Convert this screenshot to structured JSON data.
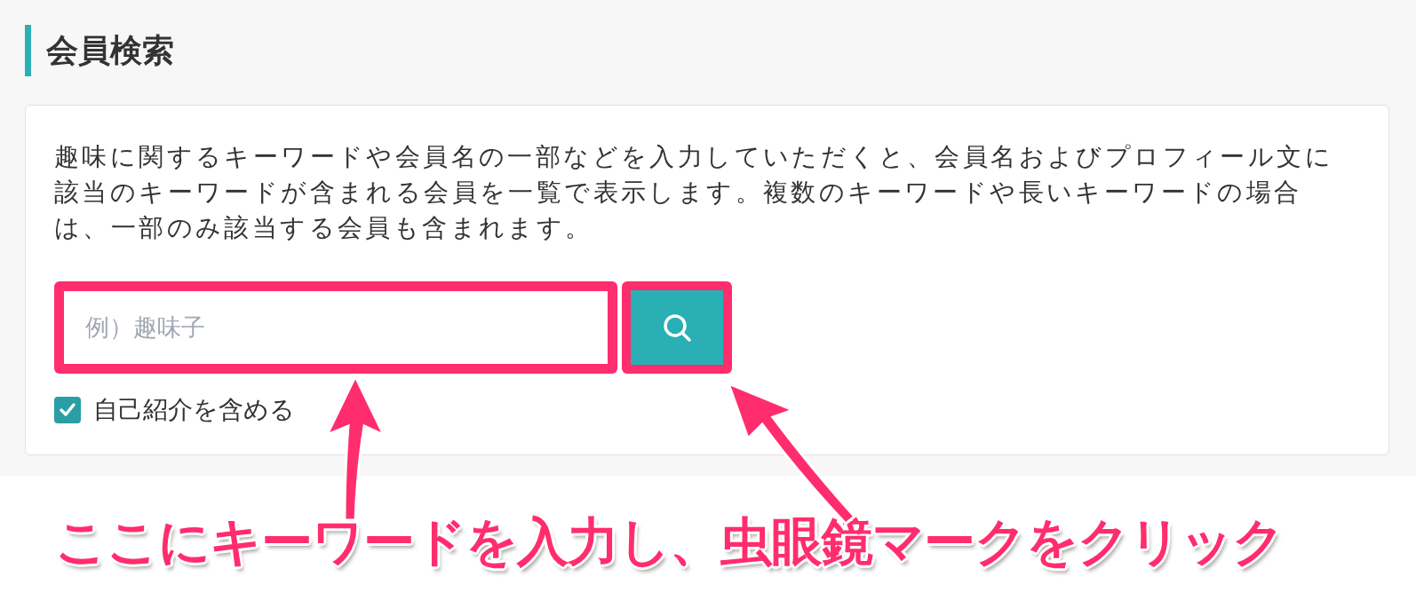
{
  "section": {
    "title": "会員検索"
  },
  "card": {
    "description": "趣味に関するキーワードや会員名の一部などを入力していただくと、会員名およびプロフィール文に該当のキーワードが含まれる会員を一覧で表示します。複数のキーワードや長いキーワードの場合は、一部のみ該当する会員も含まれます。",
    "search": {
      "placeholder": "例）趣味子"
    },
    "option": {
      "label": "自己紹介を含める",
      "checked": true
    }
  },
  "annotation": {
    "caption": "ここにキーワードを入力し、虫眼鏡マークをクリック"
  }
}
